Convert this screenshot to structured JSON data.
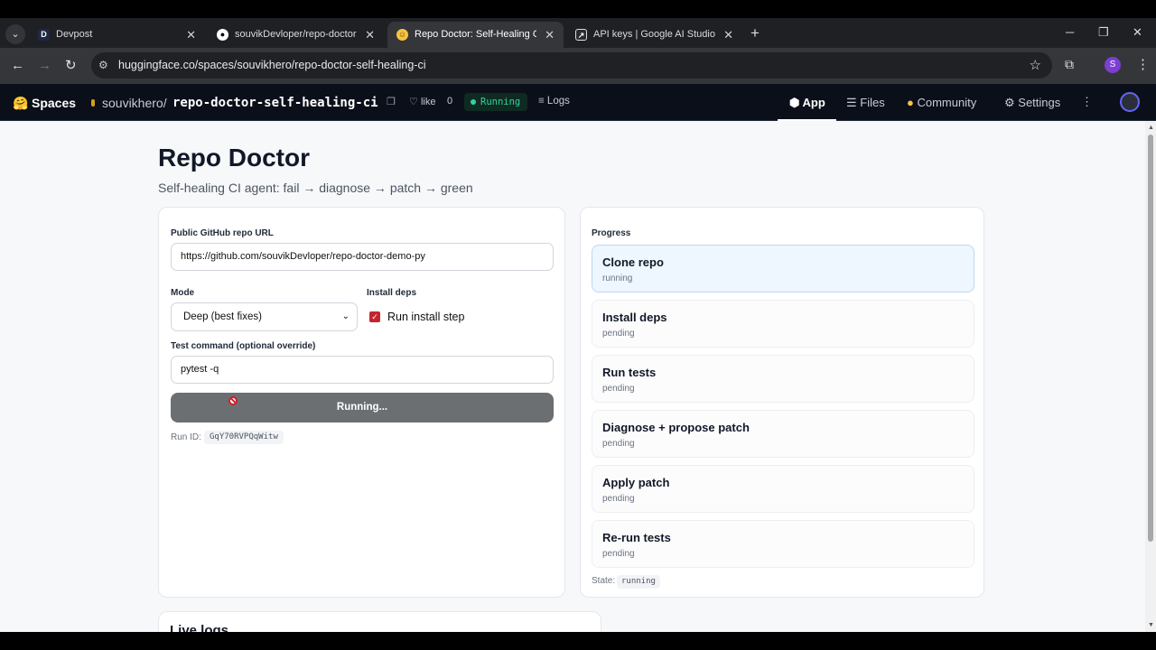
{
  "browser": {
    "tabs": [
      {
        "title": "Devpost",
        "favicon": "D"
      },
      {
        "title": "souvikDevloper/repo-doctor-de",
        "favicon": "github-icon"
      },
      {
        "title": "Repo Doctor: Self-Healing CI Ag",
        "favicon": "hf-icon"
      },
      {
        "title": "API keys | Google AI Studio",
        "favicon": "ai-studio-icon"
      }
    ],
    "url": "huggingface.co/spaces/souvikhero/repo-doctor-self-healing-ci",
    "profile_initial": "S"
  },
  "hf": {
    "spaces": "Spaces",
    "owner": "souvikhero/",
    "repo": "repo-doctor-self-healing-ci",
    "like_label": "like",
    "like_count": "0",
    "status": "Running",
    "logs": "Logs",
    "nav": {
      "app": "App",
      "files": "Files",
      "community": "Community",
      "settings": "Settings"
    }
  },
  "page": {
    "title": "Repo Doctor",
    "subtitle": "Self-healing CI agent: fail → diagnose → patch → green"
  },
  "form": {
    "repo_label": "Public GitHub repo URL",
    "repo_value": "https://github.com/souvikDevloper/repo-doctor-demo-py",
    "mode_label": "Mode",
    "mode_value": "Deep (best fixes)",
    "deps_label": "Install deps",
    "deps_checkbox_label": "Run install step",
    "deps_checked": true,
    "test_label": "Test command (optional override)",
    "test_value": "pytest -q",
    "button_label": "Running...",
    "run_id_label": "Run ID:",
    "run_id": "GqY70RVPQqWitw"
  },
  "progress": {
    "label": "Progress",
    "steps": [
      {
        "name": "Clone repo",
        "status": "running"
      },
      {
        "name": "Install deps",
        "status": "pending"
      },
      {
        "name": "Run tests",
        "status": "pending"
      },
      {
        "name": "Diagnose + propose patch",
        "status": "pending"
      },
      {
        "name": "Apply patch",
        "status": "pending"
      },
      {
        "name": "Re-run tests",
        "status": "pending"
      }
    ],
    "state_label": "State:",
    "state": "running"
  },
  "logs": {
    "title": "Live logs"
  },
  "colors": {
    "accent": "#34d399",
    "checkbox": "#c2262f",
    "button": "#6b6f72",
    "active_step": "#eef6ff"
  }
}
